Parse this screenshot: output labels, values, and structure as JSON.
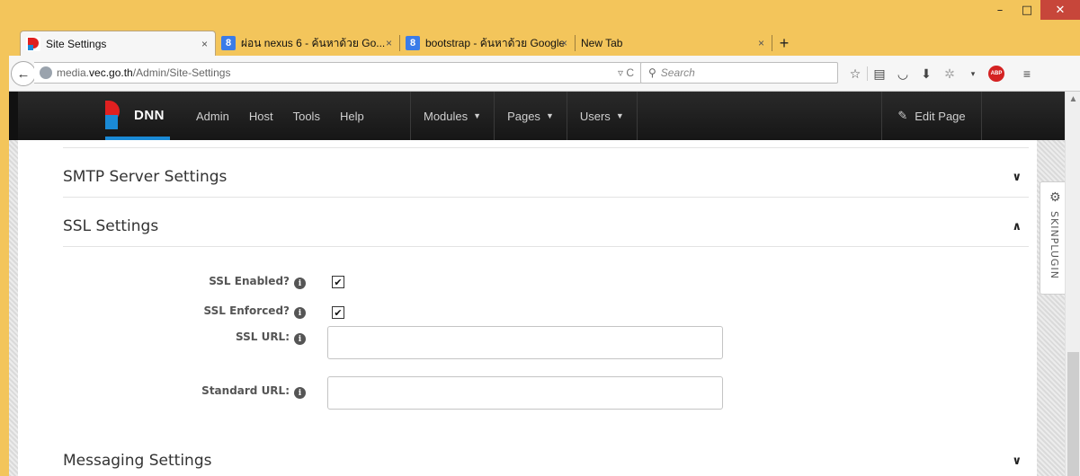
{
  "window": {
    "minimize": "–",
    "maximize": "□",
    "close": "✕"
  },
  "tabs": [
    {
      "title": "Site Settings",
      "favicon": "dnn-icon",
      "close": "×"
    },
    {
      "title": "ผ่อน nexus 6 - ค้นหาด้วย Go...",
      "favicon": "google-icon",
      "close": "×"
    },
    {
      "title": "bootstrap - ค้นหาด้วย Google",
      "favicon": "google-icon",
      "close": "×"
    },
    {
      "title": "New Tab",
      "favicon": "",
      "close": "×"
    }
  ],
  "new_tab_label": "+",
  "navbar": {
    "url_prefix": "media.",
    "url_domain": "vec.go.th",
    "url_path": "/Admin/Site-Settings",
    "url_tail": "▿ C",
    "search_placeholder": "Search"
  },
  "dnn_bar": {
    "logo_text": "DNN",
    "nav": [
      "Admin",
      "Host",
      "Tools",
      "Help"
    ],
    "menus": [
      "Modules",
      "Pages",
      "Users"
    ],
    "edit_page": "Edit Page"
  },
  "sections": {
    "smtp": "SMTP Server Settings",
    "ssl": "SSL Settings",
    "messaging": "Messaging Settings"
  },
  "ssl_fields": {
    "ssl_enabled_label": "SSL Enabled?",
    "ssl_enabled_checked": true,
    "ssl_enforced_label": "SSL Enforced?",
    "ssl_enforced_checked": true,
    "ssl_url_label": "SSL URL:",
    "ssl_url_value": "",
    "standard_url_label": "Standard URL:",
    "standard_url_value": ""
  },
  "skinplugin": {
    "label": "SKINPLUGIN",
    "icon": "gear-icon"
  }
}
